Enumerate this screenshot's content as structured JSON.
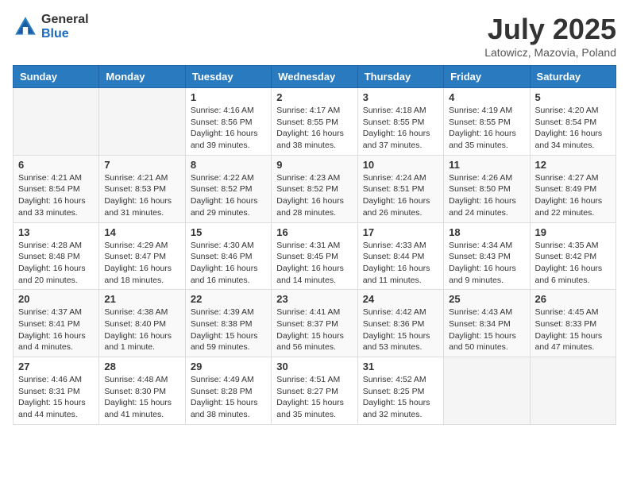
{
  "header": {
    "logo_general": "General",
    "logo_blue": "Blue",
    "month": "July 2025",
    "location": "Latowicz, Mazovia, Poland"
  },
  "weekdays": [
    "Sunday",
    "Monday",
    "Tuesday",
    "Wednesday",
    "Thursday",
    "Friday",
    "Saturday"
  ],
  "weeks": [
    [
      {
        "day": "",
        "info": ""
      },
      {
        "day": "",
        "info": ""
      },
      {
        "day": "1",
        "info": "Sunrise: 4:16 AM\nSunset: 8:56 PM\nDaylight: 16 hours\nand 39 minutes."
      },
      {
        "day": "2",
        "info": "Sunrise: 4:17 AM\nSunset: 8:55 PM\nDaylight: 16 hours\nand 38 minutes."
      },
      {
        "day": "3",
        "info": "Sunrise: 4:18 AM\nSunset: 8:55 PM\nDaylight: 16 hours\nand 37 minutes."
      },
      {
        "day": "4",
        "info": "Sunrise: 4:19 AM\nSunset: 8:55 PM\nDaylight: 16 hours\nand 35 minutes."
      },
      {
        "day": "5",
        "info": "Sunrise: 4:20 AM\nSunset: 8:54 PM\nDaylight: 16 hours\nand 34 minutes."
      }
    ],
    [
      {
        "day": "6",
        "info": "Sunrise: 4:21 AM\nSunset: 8:54 PM\nDaylight: 16 hours\nand 33 minutes."
      },
      {
        "day": "7",
        "info": "Sunrise: 4:21 AM\nSunset: 8:53 PM\nDaylight: 16 hours\nand 31 minutes."
      },
      {
        "day": "8",
        "info": "Sunrise: 4:22 AM\nSunset: 8:52 PM\nDaylight: 16 hours\nand 29 minutes."
      },
      {
        "day": "9",
        "info": "Sunrise: 4:23 AM\nSunset: 8:52 PM\nDaylight: 16 hours\nand 28 minutes."
      },
      {
        "day": "10",
        "info": "Sunrise: 4:24 AM\nSunset: 8:51 PM\nDaylight: 16 hours\nand 26 minutes."
      },
      {
        "day": "11",
        "info": "Sunrise: 4:26 AM\nSunset: 8:50 PM\nDaylight: 16 hours\nand 24 minutes."
      },
      {
        "day": "12",
        "info": "Sunrise: 4:27 AM\nSunset: 8:49 PM\nDaylight: 16 hours\nand 22 minutes."
      }
    ],
    [
      {
        "day": "13",
        "info": "Sunrise: 4:28 AM\nSunset: 8:48 PM\nDaylight: 16 hours\nand 20 minutes."
      },
      {
        "day": "14",
        "info": "Sunrise: 4:29 AM\nSunset: 8:47 PM\nDaylight: 16 hours\nand 18 minutes."
      },
      {
        "day": "15",
        "info": "Sunrise: 4:30 AM\nSunset: 8:46 PM\nDaylight: 16 hours\nand 16 minutes."
      },
      {
        "day": "16",
        "info": "Sunrise: 4:31 AM\nSunset: 8:45 PM\nDaylight: 16 hours\nand 14 minutes."
      },
      {
        "day": "17",
        "info": "Sunrise: 4:33 AM\nSunset: 8:44 PM\nDaylight: 16 hours\nand 11 minutes."
      },
      {
        "day": "18",
        "info": "Sunrise: 4:34 AM\nSunset: 8:43 PM\nDaylight: 16 hours\nand 9 minutes."
      },
      {
        "day": "19",
        "info": "Sunrise: 4:35 AM\nSunset: 8:42 PM\nDaylight: 16 hours\nand 6 minutes."
      }
    ],
    [
      {
        "day": "20",
        "info": "Sunrise: 4:37 AM\nSunset: 8:41 PM\nDaylight: 16 hours\nand 4 minutes."
      },
      {
        "day": "21",
        "info": "Sunrise: 4:38 AM\nSunset: 8:40 PM\nDaylight: 16 hours\nand 1 minute."
      },
      {
        "day": "22",
        "info": "Sunrise: 4:39 AM\nSunset: 8:38 PM\nDaylight: 15 hours\nand 59 minutes."
      },
      {
        "day": "23",
        "info": "Sunrise: 4:41 AM\nSunset: 8:37 PM\nDaylight: 15 hours\nand 56 minutes."
      },
      {
        "day": "24",
        "info": "Sunrise: 4:42 AM\nSunset: 8:36 PM\nDaylight: 15 hours\nand 53 minutes."
      },
      {
        "day": "25",
        "info": "Sunrise: 4:43 AM\nSunset: 8:34 PM\nDaylight: 15 hours\nand 50 minutes."
      },
      {
        "day": "26",
        "info": "Sunrise: 4:45 AM\nSunset: 8:33 PM\nDaylight: 15 hours\nand 47 minutes."
      }
    ],
    [
      {
        "day": "27",
        "info": "Sunrise: 4:46 AM\nSunset: 8:31 PM\nDaylight: 15 hours\nand 44 minutes."
      },
      {
        "day": "28",
        "info": "Sunrise: 4:48 AM\nSunset: 8:30 PM\nDaylight: 15 hours\nand 41 minutes."
      },
      {
        "day": "29",
        "info": "Sunrise: 4:49 AM\nSunset: 8:28 PM\nDaylight: 15 hours\nand 38 minutes."
      },
      {
        "day": "30",
        "info": "Sunrise: 4:51 AM\nSunset: 8:27 PM\nDaylight: 15 hours\nand 35 minutes."
      },
      {
        "day": "31",
        "info": "Sunrise: 4:52 AM\nSunset: 8:25 PM\nDaylight: 15 hours\nand 32 minutes."
      },
      {
        "day": "",
        "info": ""
      },
      {
        "day": "",
        "info": ""
      }
    ]
  ]
}
